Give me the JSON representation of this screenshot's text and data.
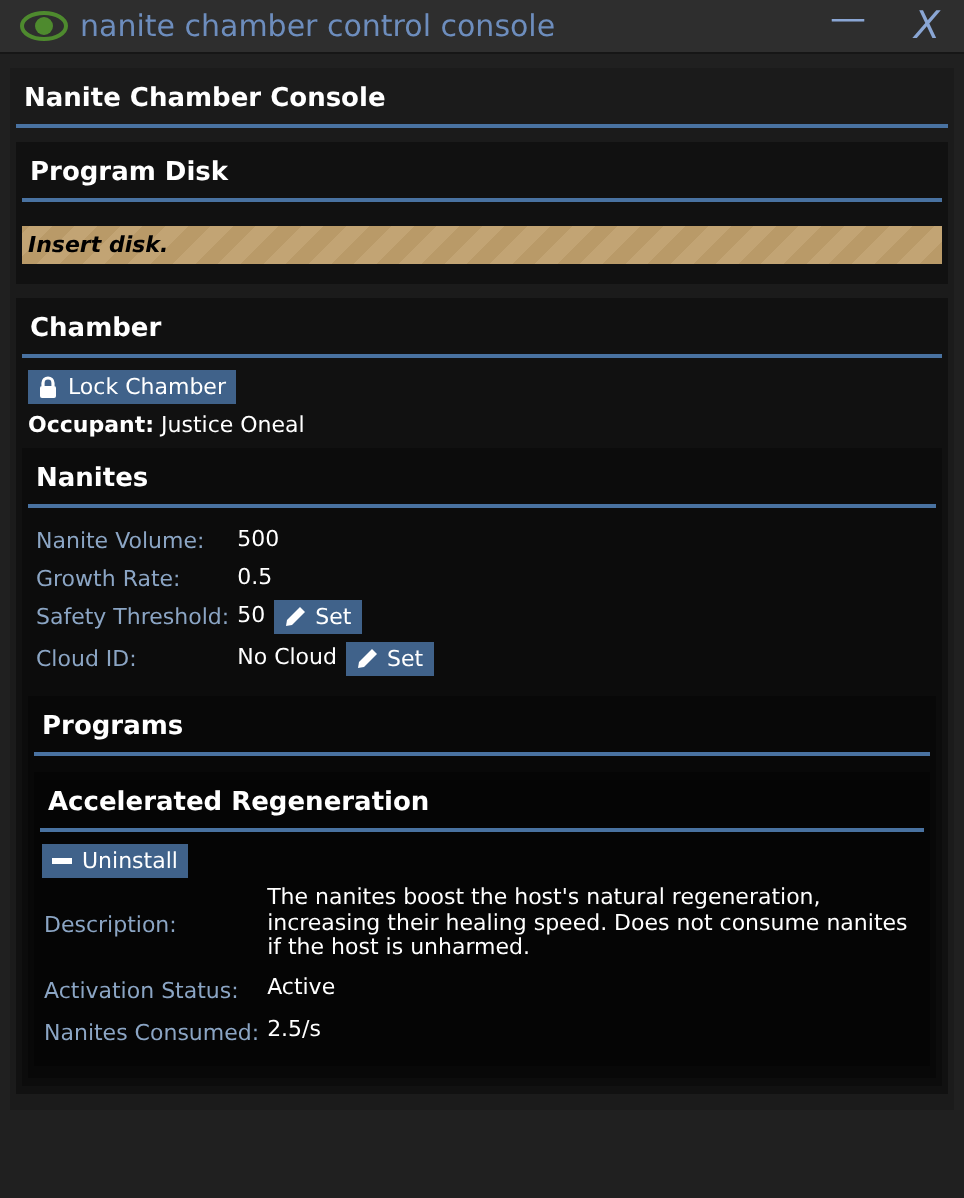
{
  "window": {
    "title": "nanite chamber control console",
    "buttons": [
      "—",
      "X"
    ]
  },
  "console": {
    "title": "Nanite Chamber Console"
  },
  "program_disk": {
    "title": "Program Disk",
    "notice": "Insert disk."
  },
  "chamber": {
    "title": "Chamber",
    "lock_button": "Lock Chamber",
    "occupant_label": "Occupant:",
    "occupant": "Justice Oneal"
  },
  "nanites": {
    "title": "Nanites",
    "rows": [
      {
        "label": "Nanite Volume:",
        "value": "500"
      },
      {
        "label": "Growth Rate:",
        "value": "0.5"
      },
      {
        "label": "Safety Threshold:",
        "value": "50",
        "button": "Set"
      },
      {
        "label": "Cloud ID:",
        "value": "No Cloud",
        "button": "Set"
      }
    ]
  },
  "programs": {
    "title": "Programs",
    "items": [
      {
        "name": "Accelerated Regeneration",
        "button": "Uninstall",
        "rows": [
          {
            "label": "Description:",
            "value": "The nanites boost the host's natural regeneration, increasing their healing speed. Does not consume nanites if the host is unharmed."
          },
          {
            "label": "Activation Status:",
            "value": "Active"
          },
          {
            "label": "Nanites Consumed:",
            "value": "2.5/s"
          }
        ]
      }
    ]
  }
}
